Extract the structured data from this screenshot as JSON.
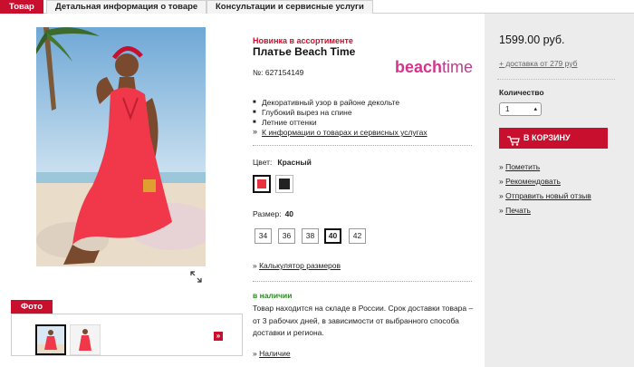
{
  "tabs": [
    {
      "label": "Товар",
      "active": true
    },
    {
      "label": "Детальная информация о товаре",
      "active": false
    },
    {
      "label": "Консультации и сервисные услуги",
      "active": false
    }
  ],
  "product": {
    "badge": "Новинка в ассортименте",
    "title": "Платье Beach Time",
    "article": "№: 627154149",
    "brand_logo": {
      "part1": "beach",
      "part2": "time"
    },
    "features": [
      "Декоративный узор в районе декольте",
      "Глубокий вырез на спине",
      "Летние оттенки"
    ],
    "info_link": "К информации о товарах и сервисных услугах",
    "color_label": "Цвет:",
    "color_value": "Красный",
    "colors": [
      {
        "name": "red",
        "hex": "#e8303f",
        "active": true
      },
      {
        "name": "black",
        "hex": "#222222",
        "active": false
      }
    ],
    "size_label": "Размер:",
    "size_value": "40",
    "sizes": [
      "34",
      "36",
      "38",
      "40",
      "42"
    ],
    "active_size": "40",
    "size_calc_link": "Калькулятор размеров",
    "stock_title": "в наличии",
    "stock_text": "Товар находится на складе в России. Срок доставки товара – от 3 рабочих дней, в зависимости от выбранного способа доставки и региона.",
    "availability_link": "Наличие"
  },
  "photos": {
    "tab_label": "Фото",
    "next_icon": "double-chevron-right-icon"
  },
  "purchase": {
    "price": "1599.00 руб.",
    "delivery": "+ доставка от 279 руб",
    "qty_label": "Количество",
    "qty_value": "1",
    "cart_button": "В КОРЗИНУ",
    "actions": [
      "Пометить",
      "Рекомендовать",
      "Отправить новый отзыв",
      "Печать"
    ]
  },
  "colors": {
    "accent": "#c8102e",
    "panel": "#ececec",
    "stock_green": "#2b8a1e"
  }
}
